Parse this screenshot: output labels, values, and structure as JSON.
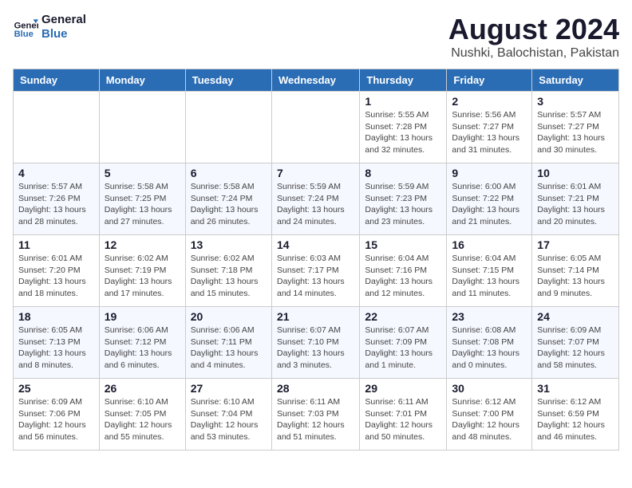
{
  "logo": {
    "line1": "General",
    "line2": "Blue"
  },
  "title": "August 2024",
  "subtitle": "Nushki, Balochistan, Pakistan",
  "weekdays": [
    "Sunday",
    "Monday",
    "Tuesday",
    "Wednesday",
    "Thursday",
    "Friday",
    "Saturday"
  ],
  "weeks": [
    [
      {
        "day": "",
        "info": ""
      },
      {
        "day": "",
        "info": ""
      },
      {
        "day": "",
        "info": ""
      },
      {
        "day": "",
        "info": ""
      },
      {
        "day": "1",
        "info": "Sunrise: 5:55 AM\nSunset: 7:28 PM\nDaylight: 13 hours\nand 32 minutes."
      },
      {
        "day": "2",
        "info": "Sunrise: 5:56 AM\nSunset: 7:27 PM\nDaylight: 13 hours\nand 31 minutes."
      },
      {
        "day": "3",
        "info": "Sunrise: 5:57 AM\nSunset: 7:27 PM\nDaylight: 13 hours\nand 30 minutes."
      }
    ],
    [
      {
        "day": "4",
        "info": "Sunrise: 5:57 AM\nSunset: 7:26 PM\nDaylight: 13 hours\nand 28 minutes."
      },
      {
        "day": "5",
        "info": "Sunrise: 5:58 AM\nSunset: 7:25 PM\nDaylight: 13 hours\nand 27 minutes."
      },
      {
        "day": "6",
        "info": "Sunrise: 5:58 AM\nSunset: 7:24 PM\nDaylight: 13 hours\nand 26 minutes."
      },
      {
        "day": "7",
        "info": "Sunrise: 5:59 AM\nSunset: 7:24 PM\nDaylight: 13 hours\nand 24 minutes."
      },
      {
        "day": "8",
        "info": "Sunrise: 5:59 AM\nSunset: 7:23 PM\nDaylight: 13 hours\nand 23 minutes."
      },
      {
        "day": "9",
        "info": "Sunrise: 6:00 AM\nSunset: 7:22 PM\nDaylight: 13 hours\nand 21 minutes."
      },
      {
        "day": "10",
        "info": "Sunrise: 6:01 AM\nSunset: 7:21 PM\nDaylight: 13 hours\nand 20 minutes."
      }
    ],
    [
      {
        "day": "11",
        "info": "Sunrise: 6:01 AM\nSunset: 7:20 PM\nDaylight: 13 hours\nand 18 minutes."
      },
      {
        "day": "12",
        "info": "Sunrise: 6:02 AM\nSunset: 7:19 PM\nDaylight: 13 hours\nand 17 minutes."
      },
      {
        "day": "13",
        "info": "Sunrise: 6:02 AM\nSunset: 7:18 PM\nDaylight: 13 hours\nand 15 minutes."
      },
      {
        "day": "14",
        "info": "Sunrise: 6:03 AM\nSunset: 7:17 PM\nDaylight: 13 hours\nand 14 minutes."
      },
      {
        "day": "15",
        "info": "Sunrise: 6:04 AM\nSunset: 7:16 PM\nDaylight: 13 hours\nand 12 minutes."
      },
      {
        "day": "16",
        "info": "Sunrise: 6:04 AM\nSunset: 7:15 PM\nDaylight: 13 hours\nand 11 minutes."
      },
      {
        "day": "17",
        "info": "Sunrise: 6:05 AM\nSunset: 7:14 PM\nDaylight: 13 hours\nand 9 minutes."
      }
    ],
    [
      {
        "day": "18",
        "info": "Sunrise: 6:05 AM\nSunset: 7:13 PM\nDaylight: 13 hours\nand 8 minutes."
      },
      {
        "day": "19",
        "info": "Sunrise: 6:06 AM\nSunset: 7:12 PM\nDaylight: 13 hours\nand 6 minutes."
      },
      {
        "day": "20",
        "info": "Sunrise: 6:06 AM\nSunset: 7:11 PM\nDaylight: 13 hours\nand 4 minutes."
      },
      {
        "day": "21",
        "info": "Sunrise: 6:07 AM\nSunset: 7:10 PM\nDaylight: 13 hours\nand 3 minutes."
      },
      {
        "day": "22",
        "info": "Sunrise: 6:07 AM\nSunset: 7:09 PM\nDaylight: 13 hours\nand 1 minute."
      },
      {
        "day": "23",
        "info": "Sunrise: 6:08 AM\nSunset: 7:08 PM\nDaylight: 13 hours\nand 0 minutes."
      },
      {
        "day": "24",
        "info": "Sunrise: 6:09 AM\nSunset: 7:07 PM\nDaylight: 12 hours\nand 58 minutes."
      }
    ],
    [
      {
        "day": "25",
        "info": "Sunrise: 6:09 AM\nSunset: 7:06 PM\nDaylight: 12 hours\nand 56 minutes."
      },
      {
        "day": "26",
        "info": "Sunrise: 6:10 AM\nSunset: 7:05 PM\nDaylight: 12 hours\nand 55 minutes."
      },
      {
        "day": "27",
        "info": "Sunrise: 6:10 AM\nSunset: 7:04 PM\nDaylight: 12 hours\nand 53 minutes."
      },
      {
        "day": "28",
        "info": "Sunrise: 6:11 AM\nSunset: 7:03 PM\nDaylight: 12 hours\nand 51 minutes."
      },
      {
        "day": "29",
        "info": "Sunrise: 6:11 AM\nSunset: 7:01 PM\nDaylight: 12 hours\nand 50 minutes."
      },
      {
        "day": "30",
        "info": "Sunrise: 6:12 AM\nSunset: 7:00 PM\nDaylight: 12 hours\nand 48 minutes."
      },
      {
        "day": "31",
        "info": "Sunrise: 6:12 AM\nSunset: 6:59 PM\nDaylight: 12 hours\nand 46 minutes."
      }
    ]
  ]
}
